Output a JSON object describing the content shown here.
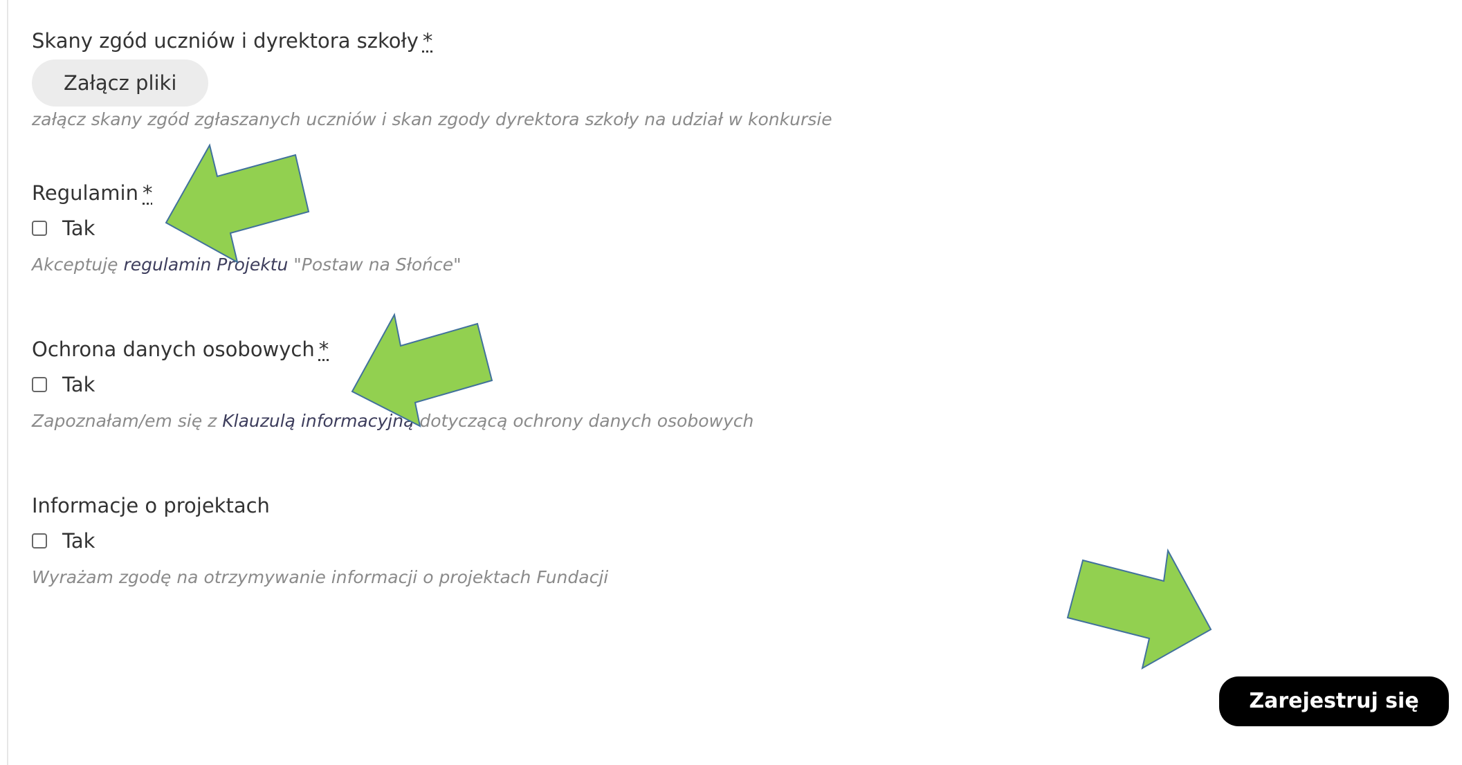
{
  "cut_heading": "",
  "consent_scans": {
    "label": "Skany zgód uczniów i dyrektora szkoły",
    "required_mark": "*",
    "upload_button": "Załącz pliki",
    "hint": "załącz skany zgód zgłaszanych uczniów i skan zgody dyrektora szkoły na udział w konkursie"
  },
  "regulations": {
    "label": "Regulamin",
    "required_mark": "*",
    "checkbox_label": "Tak",
    "hint_prefix": "Akceptuję ",
    "hint_link": "regulamin Projektu",
    "hint_suffix": " \"Postaw na Słońce\""
  },
  "data_protection": {
    "label": "Ochrona danych osobowych",
    "required_mark": "*",
    "checkbox_label": "Tak",
    "hint_prefix": "Zapoznałam/em się z ",
    "hint_link": "Klauzulą informacyjną",
    "hint_suffix": " dotyczącą ochrony danych osobowych"
  },
  "project_info": {
    "label": "Informacje o projektach",
    "checkbox_label": "Tak",
    "hint": "Wyrażam zgodę na otrzymywanie informacji o projektach Fundacji"
  },
  "submit_button": "Zarejestruj się",
  "colors": {
    "arrow_fill": "#92d050",
    "arrow_stroke": "#41719c",
    "submit_bg": "#000000",
    "upload_bg": "#ececec"
  },
  "icons": [
    "arrow-annotation-icon",
    "checkbox"
  ]
}
